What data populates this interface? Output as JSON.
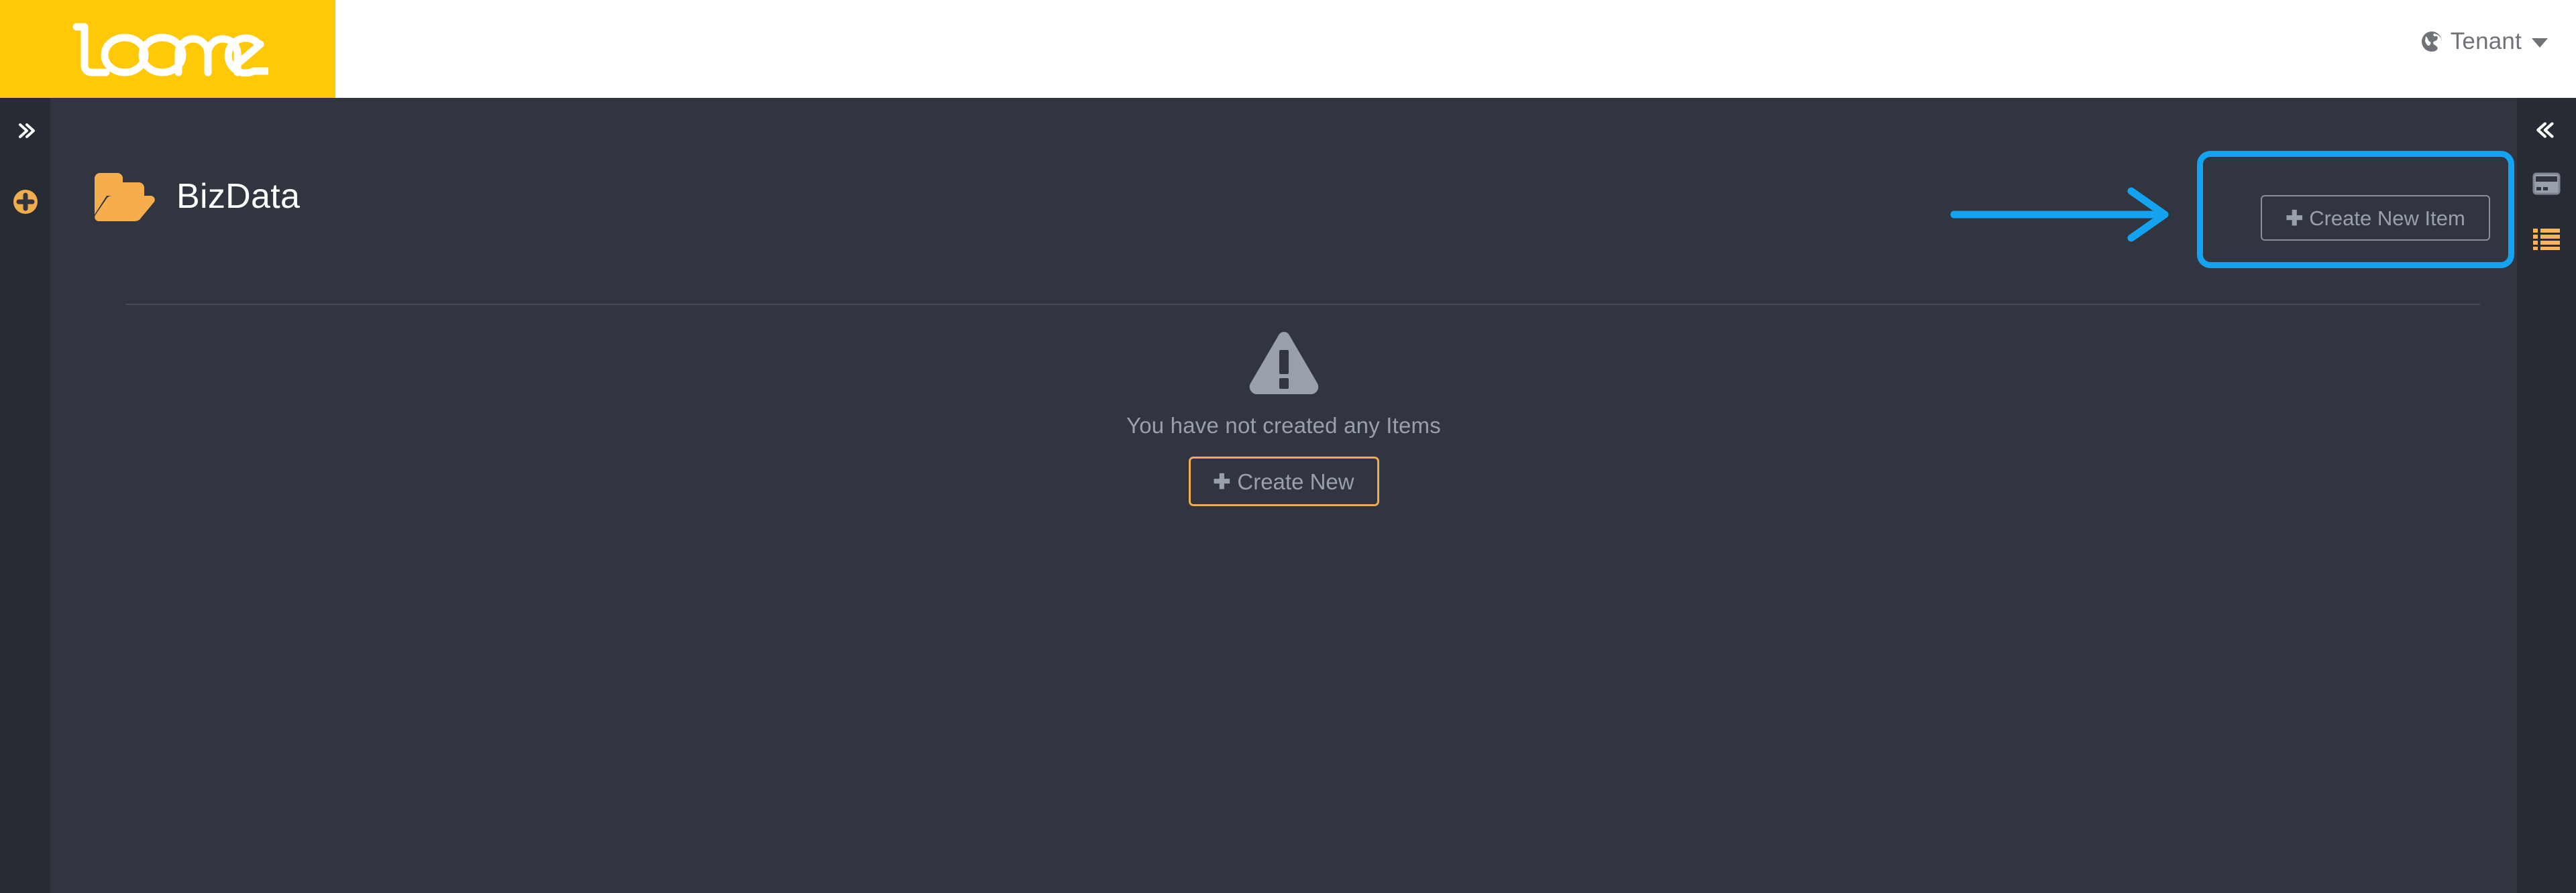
{
  "header": {
    "logo_text": "loome",
    "tenant": {
      "label": "Tenant",
      "icon": "globe-icon",
      "caret": "chevron-down-icon"
    }
  },
  "sidebar_left": {
    "expand": {
      "icon": "chevrons-right-icon",
      "label": "»"
    },
    "add": {
      "icon": "plus-circle-icon",
      "label": "+"
    }
  },
  "sidebar_right": {
    "collapse": {
      "icon": "chevrons-left-icon",
      "label": "«"
    },
    "card": {
      "icon": "card-icon"
    },
    "list": {
      "icon": "list-icon"
    }
  },
  "page": {
    "title": "BizData",
    "folder_icon": "folder-open-icon",
    "create_item_button": {
      "label": "Create New Item",
      "icon": "plus-icon"
    }
  },
  "empty_state": {
    "icon": "warning-triangle-icon",
    "message": "You have not created any Items",
    "create_button": {
      "label": "Create New",
      "icon": "plus-icon"
    }
  },
  "annotations": {
    "highlight_box": {
      "shape": "rounded-rect",
      "color": "#14a3f0",
      "target": "create-new-item-button"
    },
    "arrow": {
      "shape": "arrow-right",
      "color": "#14a3f0",
      "points_to": "create-new-item-button"
    }
  },
  "colors": {
    "brand_yellow": "#ffc907",
    "accent_orange": "#f0ad4e",
    "annotation_blue": "#14a3f0",
    "content_bg": "#31353f",
    "sidebar_bg": "#272b33",
    "muted_text": "#9aa0aa"
  }
}
